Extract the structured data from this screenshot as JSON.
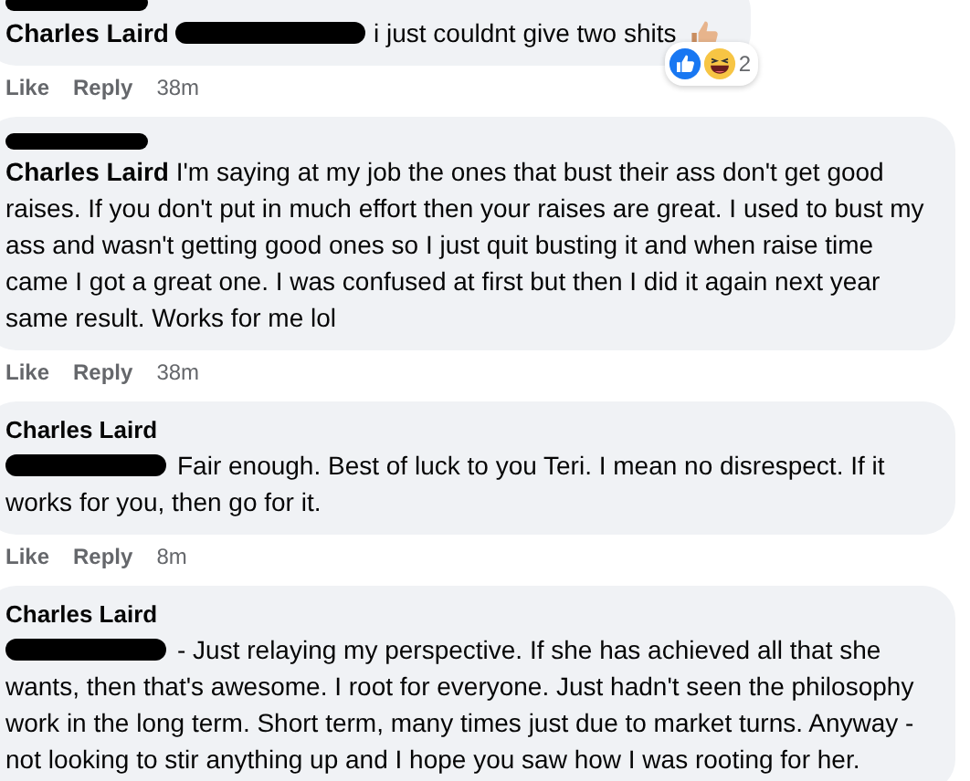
{
  "comments": [
    {
      "header_redacted": true,
      "author": "Charles Laird",
      "author_inline": true,
      "mention_redacted": true,
      "text": "i just couldnt give two shits",
      "trailing_thumb": true,
      "actions": [
        "Like",
        "Reply"
      ],
      "time": "38m",
      "reactions": {
        "count": "2"
      }
    },
    {
      "header_redacted": true,
      "mention_redacted": false,
      "text": "**Charles Laird** I'm saying at my job the ones that bust their ass don't get good raises. If you don't put in much effort then your raises are great. I used to bust my ass and wasn't getting good ones so I just quit busting it and when raise time came I got a great one. I was confused at first but then I did it again next year same result. Works for me lol",
      "trailing_thumb": false,
      "actions": [
        "Like",
        "Reply"
      ],
      "time": "38m"
    },
    {
      "header_redacted": false,
      "author": "Charles Laird",
      "author_inline": false,
      "mention_redacted": true,
      "text": "Fair enough. Best of luck to you Teri. I mean no disrespect. If it works for you, then go for it.",
      "trailing_thumb": false,
      "actions": [
        "Like",
        "Reply"
      ],
      "time": "8m"
    },
    {
      "header_redacted": false,
      "author": "Charles Laird",
      "author_inline": false,
      "mention_redacted": true,
      "text": "- Just relaying my perspective. If she has achieved all that she wants, then that's awesome. I root for everyone. Just hadn't seen the philosophy work in the long term. Short term, many times just due to market turns. Anyway - not looking to stir anything up and I hope you saw how I was rooting for her.",
      "trailing_thumb": false
    }
  ]
}
